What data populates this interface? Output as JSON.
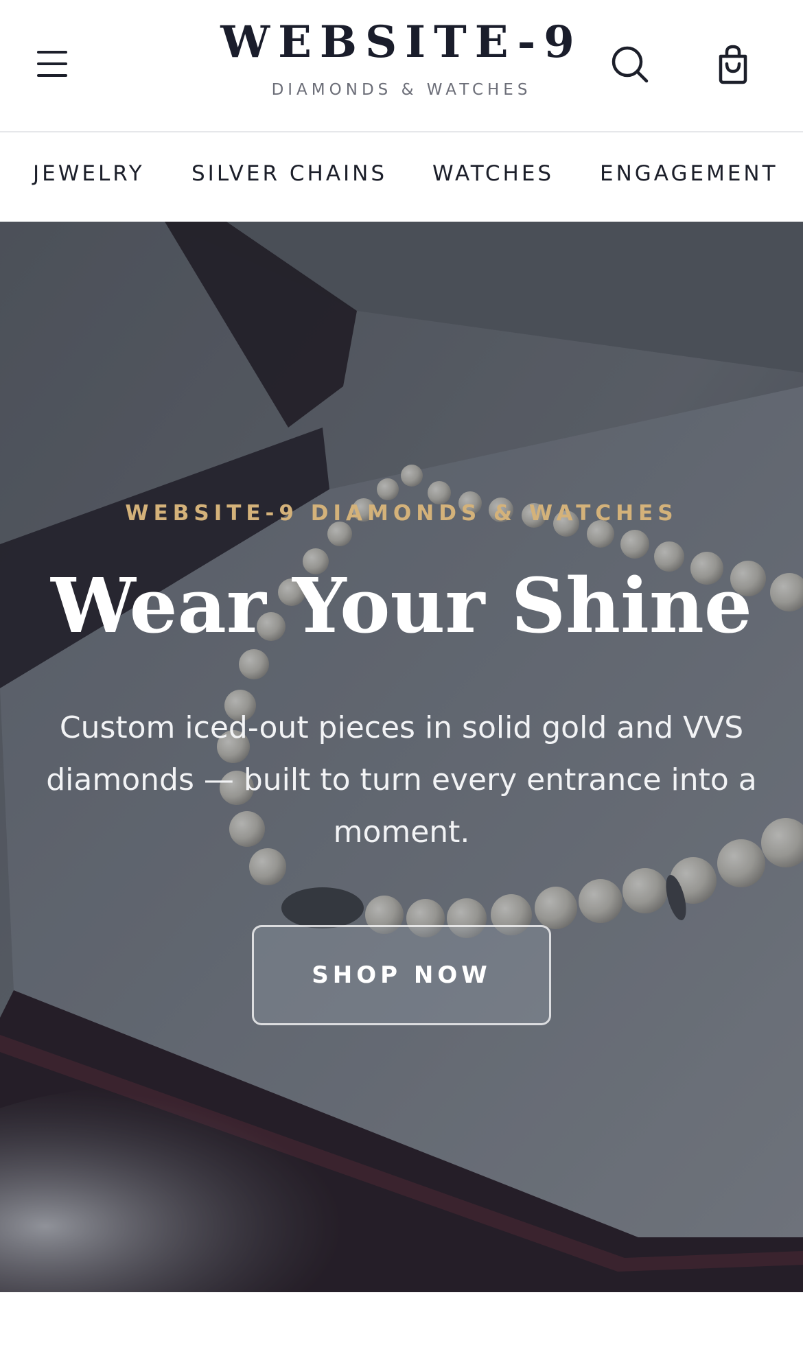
{
  "header": {
    "logo_title": "WEBSITE-9",
    "logo_subtitle": "DIAMONDS & WATCHES",
    "icons": {
      "menu": "hamburger-menu-icon",
      "search": "search-icon",
      "cart": "shopping-bag-icon"
    },
    "text_color": "#1a1d2b"
  },
  "nav": {
    "items": [
      {
        "label": "JEWELRY"
      },
      {
        "label": "SILVER CHAINS"
      },
      {
        "label": "WATCHES"
      },
      {
        "label": "ENGAGEMENT"
      }
    ]
  },
  "hero": {
    "eyebrow": "WEBSITE-9 DIAMONDS & WATCHES",
    "title": "Wear Your Shine",
    "description": "Custom iced-out pieces in solid gold and VVS diamonds — built to turn every entrance into a moment.",
    "cta_label": "SHOP NOW",
    "accent_color": "#d4b27a"
  }
}
